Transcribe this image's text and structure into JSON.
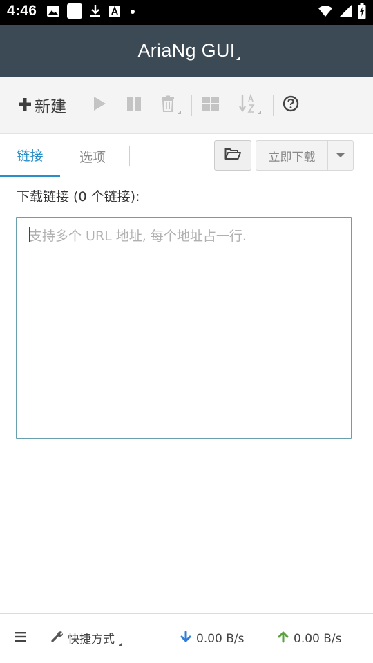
{
  "status_bar": {
    "time": "4:46",
    "left_icons": [
      "image-icon",
      "app-square-icon",
      "download-icon",
      "font-a-icon",
      "dot-icon"
    ],
    "right_icons": [
      "wifi-icon",
      "signal-icon",
      "battery-icon"
    ]
  },
  "app": {
    "title": "AriaNg GUI"
  },
  "toolbar": {
    "new_label": "新建",
    "icons": [
      "plus-icon",
      "play-icon",
      "pause-icon",
      "trash-icon",
      "grid-icon",
      "sort-az-icon",
      "help-icon"
    ]
  },
  "tabs": [
    {
      "label": "链接",
      "active": true
    },
    {
      "label": "选项",
      "active": false
    }
  ],
  "actions": {
    "download_now": "立即下载"
  },
  "main": {
    "links_label": "下载链接 (0 个链接):",
    "textarea_placeholder": "支持多个 URL 地址, 每个地址占一行.",
    "textarea_value": ""
  },
  "footer": {
    "shortcut_label": "快捷方式",
    "download_speed": "0.00 B/s",
    "upload_speed": "0.00 B/s"
  },
  "colors": {
    "title_bar": "#3c4a56",
    "accent": "#2a8fc7",
    "download_arrow": "#2f7fd6",
    "upload_arrow": "#5aa23c"
  }
}
